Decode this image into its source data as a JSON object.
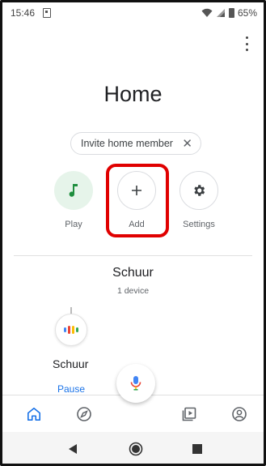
{
  "status_bar": {
    "time": "15:46",
    "battery": "65%"
  },
  "page": {
    "title": "Home"
  },
  "invite_chip": {
    "label": "Invite home member",
    "close": "✕"
  },
  "actions": [
    {
      "label": "Play",
      "icon": "music-note-icon"
    },
    {
      "label": "Add",
      "icon": "plus-icon"
    },
    {
      "label": "Settings",
      "icon": "gear-icon"
    }
  ],
  "room": {
    "name": "Schuur",
    "device_count": "1 device",
    "device": {
      "name": "Schuur",
      "action": "Pause"
    }
  },
  "bottom_nav": [
    "home-icon",
    "explore-icon",
    "media-icon",
    "account-icon"
  ],
  "colors": {
    "accent": "#1a73e8",
    "play_green": "#1e8e3e",
    "highlight": "#e00000"
  }
}
